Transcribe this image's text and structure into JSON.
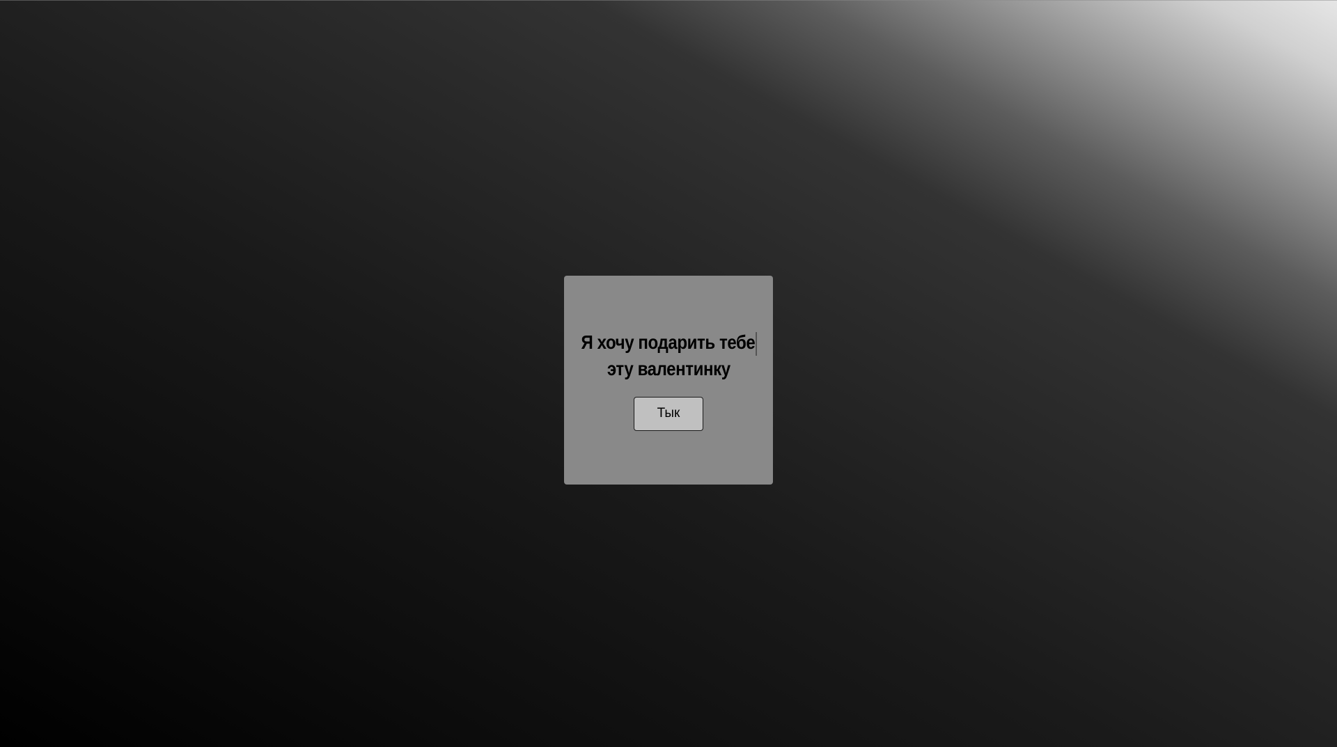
{
  "card": {
    "message_line1": "Я хочу подарить тебе",
    "message_line2": "эту валентинку",
    "button_label": "Тык"
  },
  "colors": {
    "card_background": "#898989",
    "button_background": "#c0c0c0",
    "text": "#000000",
    "page_gradient_dark": "#000000",
    "page_gradient_light": "#e6e6e6"
  }
}
